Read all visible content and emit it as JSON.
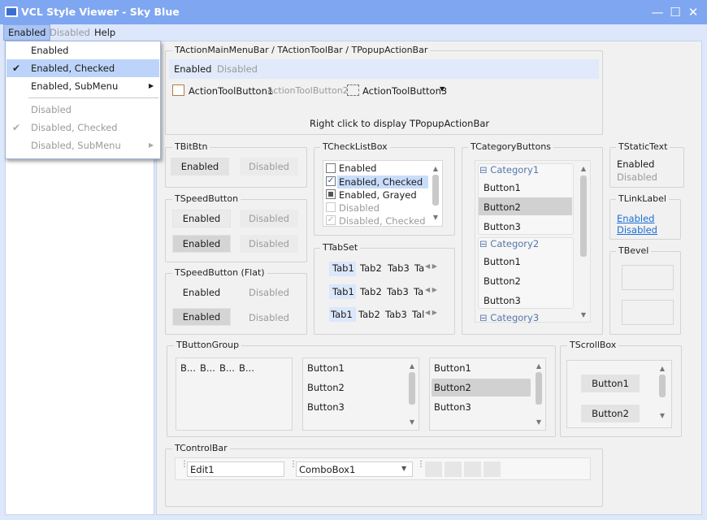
{
  "window": {
    "title": "VCL Style Viewer - Sky Blue",
    "minimize": "—",
    "maximize": "☐",
    "close": "✕"
  },
  "menubar": {
    "items": [
      {
        "label": "Enabled"
      },
      {
        "label": "Disabled"
      },
      {
        "label": "Help"
      }
    ]
  },
  "dropdown": {
    "items": [
      {
        "label": "Enabled",
        "checked": false
      },
      {
        "label": "Enabled, Checked",
        "checked": true
      },
      {
        "label": "Enabled, SubMenu",
        "submenu": true
      },
      {
        "label": "Disabled"
      },
      {
        "label": "Disabled, Checked",
        "checked": true
      },
      {
        "label": "Disabled, SubMenu",
        "submenu": true
      }
    ]
  },
  "actionbar": {
    "group": "TActionMainMenuBar / TActionToolBar / TPopupActionBar",
    "menu_enabled": "Enabled",
    "menu_disabled": "Disabled",
    "tool": [
      "ActionToolButton1",
      "ActionToolButton2",
      "ActionToolButton3"
    ],
    "hint": "Right click to display TPopupActionBar"
  },
  "bitbtn": {
    "group": "TBitBtn",
    "enabled": "Enabled",
    "disabled": "Disabled"
  },
  "speedbutton": {
    "group": "TSpeedButton",
    "enabled": "Enabled",
    "disabled": "Disabled"
  },
  "speedbutton_flat": {
    "group": "TSpeedButton (Flat)",
    "enabled": "Enabled",
    "disabled": "Disabled"
  },
  "checklistbox": {
    "group": "TCheckListBox",
    "items": [
      "Enabled",
      "Enabled, Checked",
      "Enabled, Grayed",
      "Disabled",
      "Disabled, Checked"
    ]
  },
  "tabset": {
    "group": "TTabSet",
    "tabs": [
      "Tab1",
      "Tab2",
      "Tab3",
      "Ta",
      "Tab1",
      "Tab2",
      "Tab3",
      "Ta",
      "Tab1",
      "Tab2",
      "Tab3",
      "Tal"
    ]
  },
  "categorybuttons": {
    "group": "TCategoryButtons",
    "cat1": "Category1",
    "cat2": "Category2",
    "cat3": "Category3",
    "btn1": "Button1",
    "btn2": "Button2",
    "btn3": "Button3"
  },
  "statictext": {
    "group": "TStaticText",
    "enabled": "Enabled",
    "disabled": "Disabled"
  },
  "linklabel": {
    "group": "TLinkLabel",
    "enabled": "Enabled",
    "disabled": "Disabled"
  },
  "bevel": {
    "group": "TBevel"
  },
  "buttongroup": {
    "group": "TButtonGroup",
    "compact": [
      "B...",
      "B...",
      "B...",
      "B..."
    ],
    "btn1": "Button1",
    "btn2": "Button2",
    "btn3": "Button3"
  },
  "scrollbox": {
    "group": "TScrollBox",
    "btn1": "Button1",
    "btn2": "Button2"
  },
  "controlbar": {
    "group": "TControlBar",
    "edit": "Edit1",
    "combo": "ComboBox1"
  }
}
